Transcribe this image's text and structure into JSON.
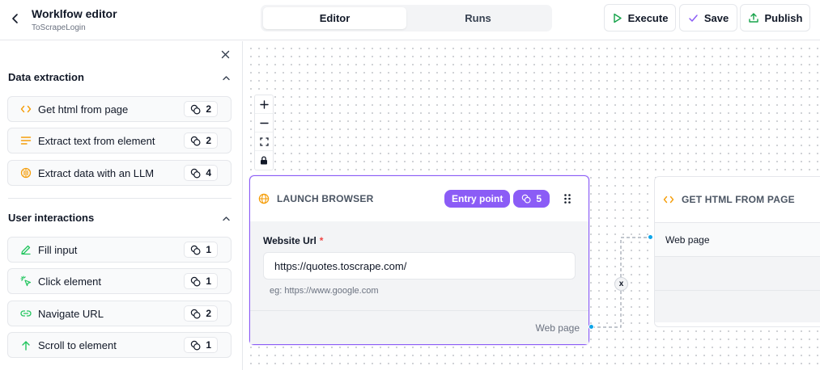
{
  "header": {
    "title": "Worklfow editor",
    "subtitle": "ToScrapeLogin",
    "tabs": [
      {
        "label": "Editor",
        "active": true
      },
      {
        "label": "Runs",
        "active": false
      }
    ],
    "buttons": {
      "execute": "Execute",
      "save": "Save",
      "publish": "Publish"
    }
  },
  "sidebar": {
    "sections": [
      {
        "title": "Data extraction",
        "items": [
          {
            "label": "Get html from page",
            "icon": "code-icon",
            "credits": "2"
          },
          {
            "label": "Extract text from element",
            "icon": "text-lines-icon",
            "credits": "2"
          },
          {
            "label": "Extract data with an LLM",
            "icon": "brain-icon",
            "credits": "4"
          }
        ]
      },
      {
        "title": "User interactions",
        "items": [
          {
            "label": "Fill input",
            "icon": "pencil-icon",
            "credits": "1"
          },
          {
            "label": "Click element",
            "icon": "pointer-click-icon",
            "credits": "1"
          },
          {
            "label": "Navigate URL",
            "icon": "link-icon",
            "credits": "2"
          },
          {
            "label": "Scroll to element",
            "icon": "arrow-up-icon",
            "credits": "1"
          }
        ]
      }
    ]
  },
  "canvas": {
    "controls": [
      "zoom-in",
      "zoom-out",
      "fit-view",
      "lock"
    ],
    "nodes": {
      "launch_browser": {
        "title": "LAUNCH BROWSER",
        "entry_label": "Entry point",
        "credits": "5",
        "field_label": "Website Url",
        "field_value": "https://quotes.toscrape.com/",
        "field_hint": "eg: https://www.google.com",
        "output_label": "Web page"
      },
      "get_html": {
        "title": "GET HTML FROM PAGE",
        "input_label": "Web page"
      }
    },
    "edge_delete_label": "x"
  },
  "colors": {
    "accent": "#8b5cf6",
    "handle": "#0ea5e9",
    "icon_amber": "#f59e0b",
    "icon_green": "#22c55e"
  }
}
